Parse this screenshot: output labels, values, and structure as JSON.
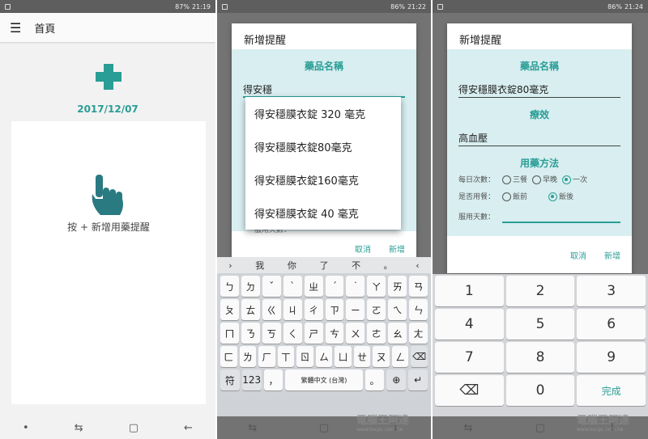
{
  "status": {
    "s1": "87%",
    "t1": "21:19",
    "s2": "86%",
    "t2": "21:22",
    "s3": "86%",
    "t3": "21:24"
  },
  "home": {
    "menu_icon": "hamburger-icon",
    "title": "首頁",
    "date": "2017/12/07",
    "hint": "按 + 新增用藥提醒"
  },
  "dialog": {
    "title": "新增提醒",
    "drug_label": "藥品名稱",
    "effect_label": "療效",
    "usage_label": "用藥方法",
    "cancel": "取消",
    "add": "新增"
  },
  "screen2": {
    "drug_value": "得安穩",
    "behind_text": "服用天數：",
    "suggestions": [
      "得安穩膜衣錠 320 毫克",
      "得安穩膜衣錠80毫克",
      "得安穩膜衣錠160毫克",
      "得安穩膜衣錠 40 毫克"
    ]
  },
  "keyboard": {
    "suggest": [
      "›",
      "我",
      "你",
      "了",
      "不",
      "。",
      "‹"
    ],
    "rows": [
      [
        "ㄅ",
        "ㄉ",
        "ˇ",
        "ˋ",
        "ㄓ",
        "ˊ",
        "˙",
        "ㄚ",
        "ㄞ",
        "ㄢ"
      ],
      [
        "ㄆ",
        "ㄊ",
        "ㄍ",
        "ㄐ",
        "ㄔ",
        "ㄗ",
        "ㄧ",
        "ㄛ",
        "ㄟ",
        "ㄣ"
      ],
      [
        "ㄇ",
        "ㄋ",
        "ㄎ",
        "ㄑ",
        "ㄕ",
        "ㄘ",
        "ㄨ",
        "ㄜ",
        "ㄠ",
        "ㄤ"
      ],
      [
        "ㄈ",
        "ㄌ",
        "ㄏ",
        "ㄒ",
        "ㄖ",
        "ㄙ",
        "ㄩ",
        "ㄝ",
        "ㄡ",
        "ㄥ"
      ]
    ],
    "bottom": [
      "符",
      "123",
      "，",
      "繁體中文 (台灣)",
      "。",
      "⊕",
      "↵"
    ],
    "backspace": "⌫"
  },
  "screen3": {
    "drug_value": "得安穩膜衣錠80毫克",
    "effect_value": "高血壓",
    "daily_label": "每日次數：",
    "daily": [
      "三餐",
      "早晚",
      "一次"
    ],
    "meal_label": "是否用餐：",
    "meal": [
      "飯前",
      "飯後"
    ],
    "days_label": "服用天數："
  },
  "numpad": {
    "rows": [
      [
        "1",
        "2",
        "3"
      ],
      [
        "4",
        "5",
        "6"
      ],
      [
        "7",
        "8",
        "9"
      ],
      [
        "⌫",
        "0",
        "完成"
      ]
    ]
  },
  "watermark": {
    "name": "電腦王阿達",
    "url": "www.kocpc.com.tw"
  },
  "accent": "#2a9d96"
}
